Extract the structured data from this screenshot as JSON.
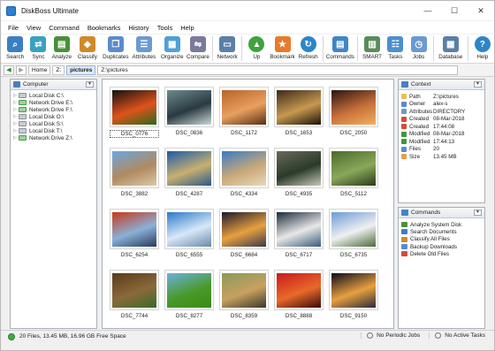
{
  "window": {
    "title": "DiskBoss Ultimate",
    "controls": [
      "—",
      "☐",
      "✕"
    ]
  },
  "menu": [
    "File",
    "View",
    "Command",
    "Bookmarks",
    "History",
    "Tools",
    "Help"
  ],
  "toolbar": [
    {
      "label": "Search",
      "icon": "search-icon",
      "color": "#3a7fc4"
    },
    {
      "label": "Sync",
      "icon": "sync-icon",
      "color": "#3aa0c0"
    },
    {
      "label": "Analyze",
      "icon": "analyze-icon",
      "color": "#4a8f3a"
    },
    {
      "label": "Classify",
      "icon": "classify-icon",
      "color": "#d08a2a"
    },
    {
      "label": "Duplicates",
      "icon": "duplicates-icon",
      "color": "#5a8ccc"
    },
    {
      "label": "Attributes",
      "icon": "attributes-icon",
      "color": "#6a9ad0"
    },
    {
      "label": "Organize",
      "icon": "organize-icon",
      "color": "#4fa0d8"
    },
    {
      "label": "Compare",
      "icon": "compare-icon",
      "color": "#7a7a9a"
    },
    {
      "label": "Network",
      "icon": "network-icon",
      "color": "#5a7fa8"
    },
    {
      "label": "Up",
      "icon": "up-arrow-icon",
      "color": "#3fa33f"
    },
    {
      "label": "Bookmark",
      "icon": "bookmark-star-icon",
      "color": "#e87a2a"
    },
    {
      "label": "Refresh",
      "icon": "refresh-icon",
      "color": "#2d86c8"
    },
    {
      "label": "Commands",
      "icon": "commands-icon",
      "color": "#3f86c8"
    },
    {
      "label": "SMART",
      "icon": "smart-icon",
      "color": "#5a8c5a"
    },
    {
      "label": "Tasks",
      "icon": "tasks-icon",
      "color": "#4a8fd0"
    },
    {
      "label": "Jobs",
      "icon": "jobs-icon",
      "color": "#6a9ad0"
    },
    {
      "label": "Database",
      "icon": "database-icon",
      "color": "#5a7fa8"
    },
    {
      "label": "Help",
      "icon": "help-icon",
      "color": "#2d86c8"
    }
  ],
  "address": {
    "breadcrumbs": [
      "Home",
      "Z:",
      "pictures"
    ],
    "path": "Z:\\pictures"
  },
  "left_panel": {
    "title": "Computer",
    "drives": [
      {
        "label": "Local Disk C:\\",
        "type": "local"
      },
      {
        "label": "Network Drive E:\\",
        "type": "network"
      },
      {
        "label": "Network Drive F:\\",
        "type": "network"
      },
      {
        "label": "Local Disk O:\\",
        "type": "local"
      },
      {
        "label": "Local Disk S:\\",
        "type": "local"
      },
      {
        "label": "Local Disk T:\\",
        "type": "local"
      },
      {
        "label": "Network Drive Z:\\",
        "type": "network"
      }
    ]
  },
  "thumbnails": [
    {
      "name": "DSC_0776",
      "colors": [
        "#111111",
        "#e0521c",
        "#2a6a1a"
      ],
      "selected": true
    },
    {
      "name": "DSC_0836",
      "colors": [
        "#6c8b8e",
        "#2a3a40",
        "#c8d8d8"
      ]
    },
    {
      "name": "DSC_1172",
      "colors": [
        "#b8622a",
        "#e8a060",
        "#5a2e14"
      ]
    },
    {
      "name": "DSC_1653",
      "colors": [
        "#3a2a1a",
        "#c89850",
        "#1a120a"
      ]
    },
    {
      "name": "DSC_2050",
      "colors": [
        "#2a1410",
        "#c8703a",
        "#f0b060"
      ]
    },
    {
      "name": "DSC_3882",
      "colors": [
        "#6aa8e0",
        "#b08a60",
        "#d8c8a8"
      ]
    },
    {
      "name": "DSC_4287",
      "colors": [
        "#1a5aa8",
        "#c8b070",
        "#2a5a8a"
      ]
    },
    {
      "name": "DSC_4334",
      "colors": [
        "#3a7ac8",
        "#c8a878",
        "#e8d8b8"
      ]
    },
    {
      "name": "DSC_4935",
      "colors": [
        "#6a6a58",
        "#2a3a2a",
        "#c8c8b8"
      ]
    },
    {
      "name": "DSC_5112",
      "colors": [
        "#4a6a2a",
        "#8aa85a",
        "#2a3a1a"
      ]
    },
    {
      "name": "DSC_6254",
      "colors": [
        "#c8381a",
        "#8ab0d8",
        "#2a3a5a"
      ]
    },
    {
      "name": "DSC_6555",
      "colors": [
        "#2a78c8",
        "#d8e8f8",
        "#6a8aa8"
      ]
    },
    {
      "name": "DSC_6684",
      "colors": [
        "#1a1a2a",
        "#e8a040",
        "#3a3a4a"
      ]
    },
    {
      "name": "DSC_6717",
      "colors": [
        "#1a2a3a",
        "#e8e8e8",
        "#3a5a7a"
      ]
    },
    {
      "name": "DSC_6735",
      "colors": [
        "#6a9ad8",
        "#f0f0f0",
        "#4a6a3a"
      ]
    },
    {
      "name": "DSC_7744",
      "colors": [
        "#5a3a1a",
        "#8a6a3a",
        "#3a6a2a"
      ]
    },
    {
      "name": "DSC_8277",
      "colors": [
        "#6ab0e0",
        "#4a9a2a",
        "#3a8a1a"
      ]
    },
    {
      "name": "DSC_8359",
      "colors": [
        "#8a9a5a",
        "#c8a060",
        "#3a3a2a"
      ]
    },
    {
      "name": "DSC_8888",
      "colors": [
        "#c81a1a",
        "#e86a2a",
        "#3a0a0a"
      ]
    },
    {
      "name": "DSC_9150",
      "colors": [
        "#0a0a1a",
        "#e8a040",
        "#2a2a3a"
      ]
    }
  ],
  "context_panel": {
    "title": "Context",
    "rows": [
      {
        "key": "Path",
        "value": "Z:\\pictures",
        "color": "#e8c050"
      },
      {
        "key": "Owner",
        "value": "alex-s",
        "color": "#5a8ad0"
      },
      {
        "key": "Attributes",
        "value": "DIRECTORY",
        "color": "#6a9ad0"
      },
      {
        "key": "Created",
        "value": "08-Mar-2018",
        "color": "#d84a3a"
      },
      {
        "key": "Created",
        "value": "17:44:08",
        "color": "#d84a3a"
      },
      {
        "key": "Modified",
        "value": "08-Mar-2018",
        "color": "#3a9a3a"
      },
      {
        "key": "Modified",
        "value": "17:44:13",
        "color": "#3a9a3a"
      },
      {
        "key": "Files",
        "value": "20",
        "color": "#5a8ad0"
      },
      {
        "key": "Size",
        "value": "13.45 MB",
        "color": "#e8a040"
      }
    ]
  },
  "commands_panel": {
    "title": "Commands",
    "items": [
      {
        "label": "Analyze System Disk",
        "color": "#4a8f3a"
      },
      {
        "label": "Search Documents",
        "color": "#3a7fc4"
      },
      {
        "label": "Classify All Files",
        "color": "#d08a2a"
      },
      {
        "label": "Backup Downloads",
        "color": "#5a8ad0"
      },
      {
        "label": "Delete Old Files",
        "color": "#d84a3a"
      }
    ]
  },
  "status": {
    "summary": "20 Files, 13.45 MB, 16.96 GB Free Space",
    "jobs": "No Periodic Jobs",
    "tasks": "No Active Tasks"
  }
}
